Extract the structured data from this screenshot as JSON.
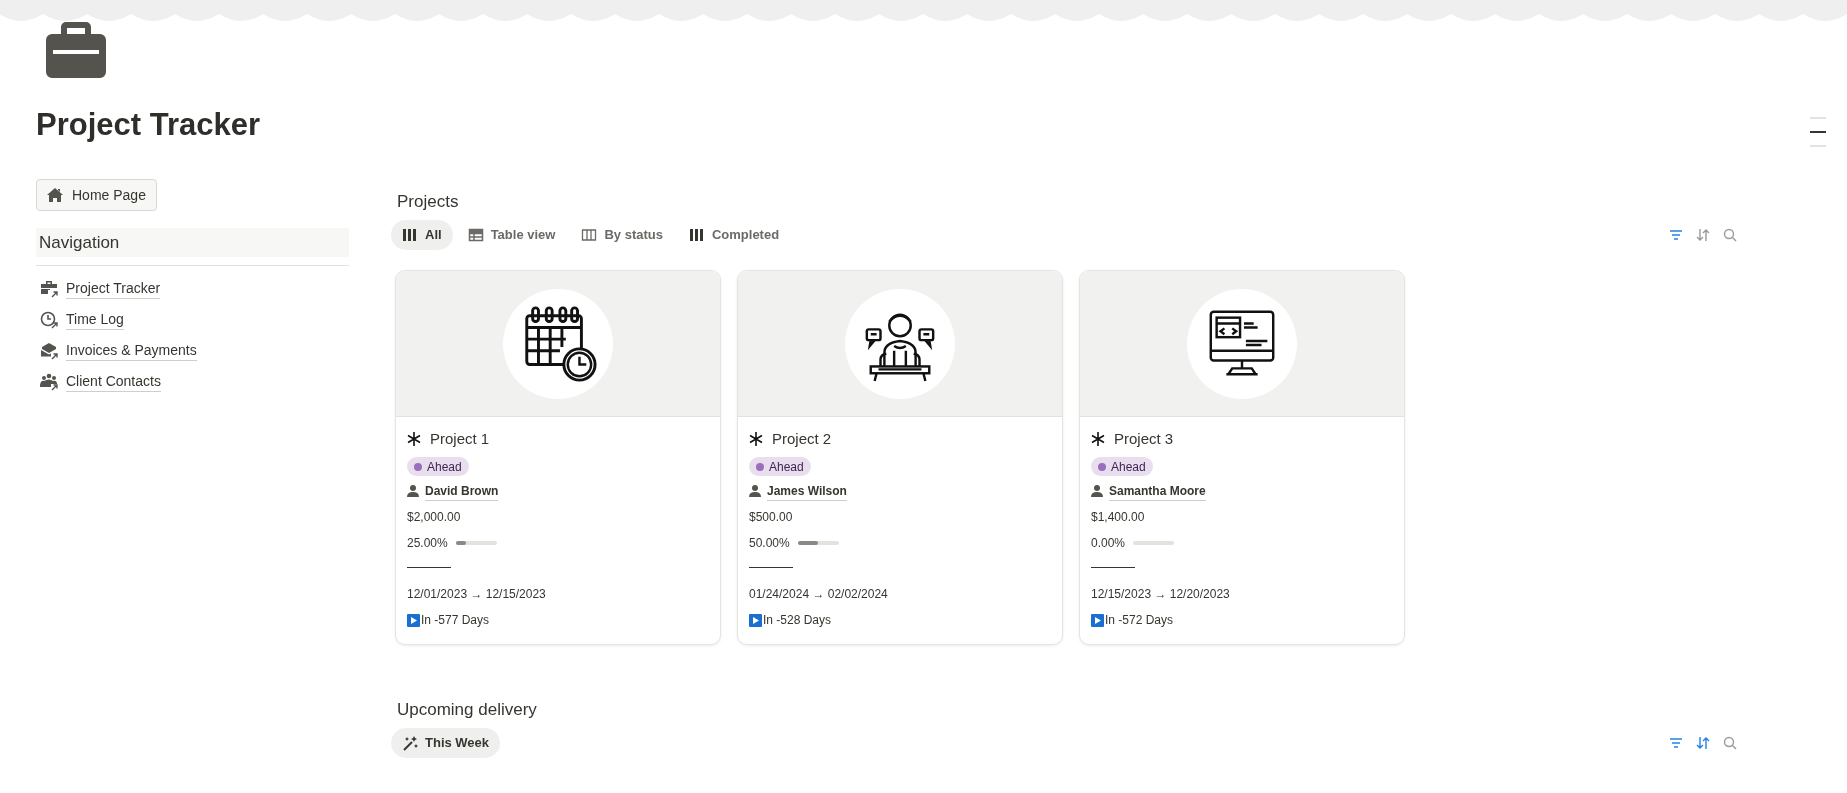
{
  "page": {
    "title": "Project Tracker"
  },
  "sidebar": {
    "home_button": "Home Page",
    "heading": "Navigation",
    "items": [
      {
        "label": "Project Tracker",
        "kind": "briefcase"
      },
      {
        "label": "Time Log",
        "kind": "clock"
      },
      {
        "label": "Invoices & Payments",
        "kind": "envelope"
      },
      {
        "label": "Client Contacts",
        "kind": "people"
      }
    ]
  },
  "projects": {
    "heading": "Projects",
    "tabs": [
      {
        "label": "All",
        "kind": "board",
        "selected": true
      },
      {
        "label": "Table view",
        "kind": "table",
        "selected": false
      },
      {
        "label": "By status",
        "kind": "columns",
        "selected": false
      },
      {
        "label": "Completed",
        "kind": "board",
        "selected": false
      }
    ],
    "toolbar": {
      "filter_active": true,
      "sort_active": false
    },
    "cards": [
      {
        "kind": "calendar",
        "title": "Project 1",
        "status": "Ahead",
        "owner": "David Brown",
        "amount": "$2,000.00",
        "progress": "25.00%",
        "level": 0.25,
        "dates": "12/01/2023 → 12/15/2023",
        "countdown": "In -577 Days"
      },
      {
        "kind": "speaker",
        "title": "Project 2",
        "status": "Ahead",
        "owner": "James Wilson",
        "amount": "$500.00",
        "progress": "50.00%",
        "level": 0.5,
        "dates": "01/24/2024 → 02/02/2024",
        "countdown": "In -528 Days"
      },
      {
        "kind": "computer",
        "title": "Project 3",
        "status": "Ahead",
        "owner": "Samantha Moore",
        "amount": "$1,400.00",
        "progress": "0.00%",
        "level": 0,
        "dates": "12/15/2023 → 12/20/2023",
        "countdown": "In -572 Days"
      }
    ]
  },
  "upcoming": {
    "heading": "Upcoming delivery",
    "tabs": [
      {
        "label": "This Week",
        "kind": "sparkle",
        "selected": true
      }
    ],
    "toolbar": {
      "filter_active": true,
      "sort_active": true
    }
  }
}
